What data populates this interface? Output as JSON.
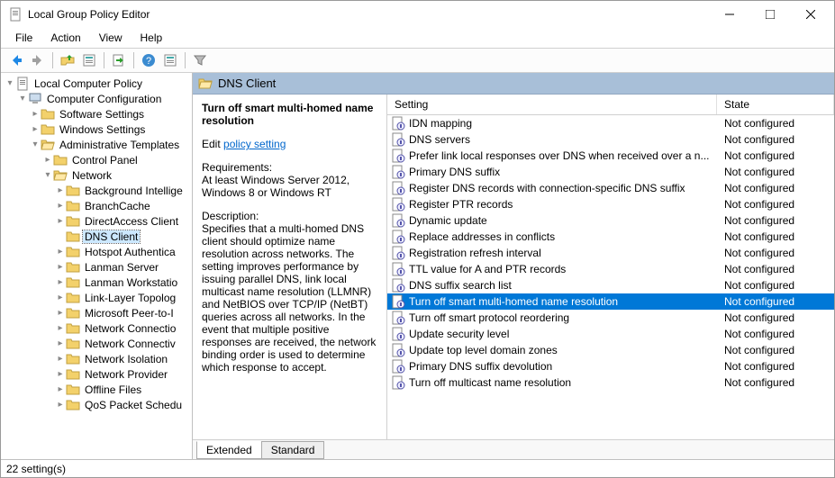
{
  "window": {
    "title": "Local Group Policy Editor"
  },
  "menu": [
    "File",
    "Action",
    "View",
    "Help"
  ],
  "tree": {
    "root": "Local Computer Policy",
    "cc": "Computer Configuration",
    "sw": "Software Settings",
    "ws": "Windows Settings",
    "at": "Administrative Templates",
    "cp": "Control Panel",
    "net": "Network",
    "children": [
      "Background Intellige",
      "BranchCache",
      "DirectAccess Client",
      "DNS Client",
      "Hotspot Authentica",
      "Lanman Server",
      "Lanman Workstatio",
      "Link-Layer Topolog",
      "Microsoft Peer-to-I",
      "Network Connectio",
      "Network Connectiv",
      "Network Isolation",
      "Network Provider",
      "Offline Files",
      "QoS Packet Schedu"
    ]
  },
  "breadcrumb": "DNS Client",
  "desc": {
    "title": "Turn off smart multi-homed name resolution",
    "editPrefix": "Edit",
    "editLink": "policy setting",
    "reqHead": "Requirements:",
    "reqBody": "At least Windows Server 2012, Windows 8 or Windows RT",
    "descHead": "Description:",
    "descBody": "Specifies that a multi-homed DNS client should optimize name resolution across networks.  The setting improves performance by issuing parallel DNS, link local multicast name resolution (LLMNR) and NetBIOS over TCP/IP (NetBT) queries across all networks. In the event that multiple positive responses are received, the network binding order is used to determine which response to accept."
  },
  "listHeader": {
    "setting": "Setting",
    "state": "State"
  },
  "settings": [
    {
      "name": "IDN mapping",
      "state": "Not configured"
    },
    {
      "name": "DNS servers",
      "state": "Not configured"
    },
    {
      "name": "Prefer link local responses over DNS when received over a n...",
      "state": "Not configured"
    },
    {
      "name": "Primary DNS suffix",
      "state": "Not configured"
    },
    {
      "name": "Register DNS records with connection-specific DNS suffix",
      "state": "Not configured"
    },
    {
      "name": "Register PTR records",
      "state": "Not configured"
    },
    {
      "name": "Dynamic update",
      "state": "Not configured"
    },
    {
      "name": "Replace addresses in conflicts",
      "state": "Not configured"
    },
    {
      "name": "Registration refresh interval",
      "state": "Not configured"
    },
    {
      "name": "TTL value for A and PTR records",
      "state": "Not configured"
    },
    {
      "name": "DNS suffix search list",
      "state": "Not configured"
    },
    {
      "name": "Turn off smart multi-homed name resolution",
      "state": "Not configured",
      "selected": true
    },
    {
      "name": "Turn off smart protocol reordering",
      "state": "Not configured"
    },
    {
      "name": "Update security level",
      "state": "Not configured"
    },
    {
      "name": "Update top level domain zones",
      "state": "Not configured"
    },
    {
      "name": "Primary DNS suffix devolution",
      "state": "Not configured"
    },
    {
      "name": "Turn off multicast name resolution",
      "state": "Not configured"
    }
  ],
  "tabs": {
    "extended": "Extended",
    "standard": "Standard"
  },
  "status": "22 setting(s)"
}
